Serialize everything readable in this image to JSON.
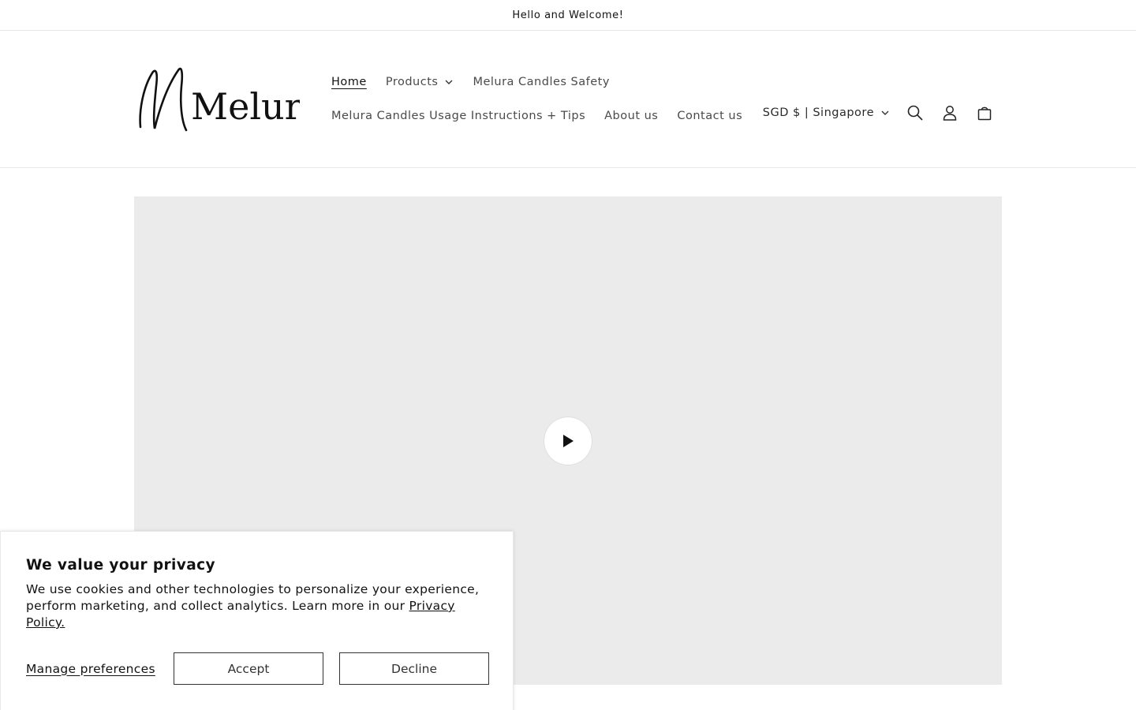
{
  "announcement": {
    "text": "Hello and Welcome!"
  },
  "logo": {
    "text": "Melura"
  },
  "nav": {
    "row1": [
      {
        "label": "Home",
        "active": true
      },
      {
        "label": "Products",
        "has_dropdown": true
      },
      {
        "label": "Melura Candles Safety"
      }
    ],
    "row2": [
      {
        "label": "Melura Candles Usage Instructions + Tips"
      },
      {
        "label": "About us"
      },
      {
        "label": "Contact us"
      }
    ]
  },
  "header_tools": {
    "country": "SGD $ | Singapore",
    "icons": [
      "search-icon",
      "account-icon",
      "cart-icon"
    ]
  },
  "video": {
    "play_icon": "play-icon",
    "background": "#ebebeb"
  },
  "cookie_banner": {
    "title": "We value your privacy",
    "body": "We use cookies and other technologies to personalize your experience, perform marketing, and collect analytics. Learn more in our ",
    "privacy_link": "Privacy Policy.",
    "manage_label": "Manage preferences",
    "accept_label": "Accept",
    "decline_label": "Decline"
  }
}
